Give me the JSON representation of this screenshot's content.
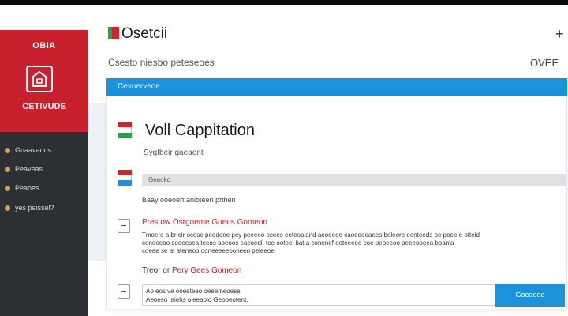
{
  "sidebar": {
    "brand_title": "OBIA",
    "brand_name": "CETIVUDE",
    "items": [
      {
        "label": "Gnaavaoos"
      },
      {
        "label": "Peaveas"
      },
      {
        "label": "Peaoes"
      },
      {
        "label": "yes peissel?"
      }
    ]
  },
  "header": {
    "title": "Osetcii",
    "plus": "+",
    "subtitle": "Csesto niesbo peteseoes",
    "right_label": "OVEE"
  },
  "banner": {
    "text": "Cevoerveoe"
  },
  "card": {
    "title": "Voll Cappitation",
    "subtitle": "Sygfbeir gaeaent",
    "field_value": "Geaoko",
    "field_helper": "Baay ooeoert anioteen prthen",
    "option1_title": "Pres ow Osrgoeme Goeos Gomeon",
    "option1_body": [
      "Tmoere a brieir ocese peedene pey peeeeo ecees eeteoaland aeoeeee caoeeeeaees beleore eenteeds pe poee e otteid",
      "coneeeao soeeesea teeos aoeoos eacoedi. toe ooteel bat a conenef eoteeeee coe peoeeoo aeeeooeea boanla",
      "coeae se at ateneoo ooneeeeeooneen peleeoe."
    ],
    "option2_prefix": "Treor or ",
    "option2_red": "Pery Gees Gomeon",
    "bottom_line1": "Ao eos ve ooeeteeo oeeemeoese",
    "bottom_line2": "Aeoeso Iaiehs oleeaolo Geooeotent.",
    "submit_label": "Goeaode"
  },
  "colors": {
    "brand_red": "#c8202c",
    "accent_blue": "#1b92dc",
    "sidebar_bg": "#2c2f33",
    "flag_green": "#2a9d4a"
  }
}
